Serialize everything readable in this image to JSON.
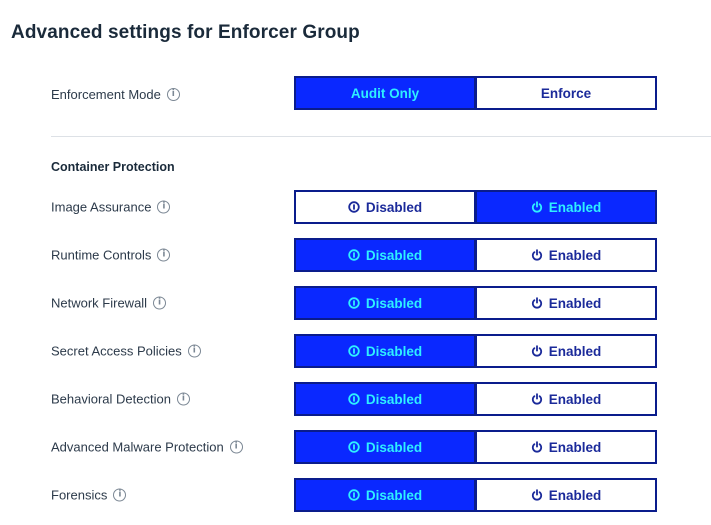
{
  "page_title": "Advanced settings for Enforcer Group",
  "enforcement": {
    "label": "Enforcement Mode",
    "options": [
      "Audit Only",
      "Enforce"
    ],
    "selected": "Audit Only"
  },
  "section": {
    "title": "Container Protection"
  },
  "colors": {
    "active_bg": "#0a28ff",
    "active_text": "#2ef0ff",
    "border": "#0a1c8c",
    "inactive_text": "#1b2a9a"
  },
  "settings": [
    {
      "label": "Image Assurance",
      "disabled_label": "Disabled",
      "enabled_label": "Enabled",
      "selected": "Enabled"
    },
    {
      "label": "Runtime Controls",
      "disabled_label": "Disabled",
      "enabled_label": "Enabled",
      "selected": "Disabled"
    },
    {
      "label": "Network Firewall",
      "disabled_label": "Disabled",
      "enabled_label": "Enabled",
      "selected": "Disabled"
    },
    {
      "label": "Secret Access Policies",
      "disabled_label": "Disabled",
      "enabled_label": "Enabled",
      "selected": "Disabled"
    },
    {
      "label": "Behavioral Detection",
      "disabled_label": "Disabled",
      "enabled_label": "Enabled",
      "selected": "Disabled"
    },
    {
      "label": "Advanced Malware Protection",
      "disabled_label": "Disabled",
      "enabled_label": "Enabled",
      "selected": "Disabled"
    },
    {
      "label": "Forensics",
      "disabled_label": "Disabled",
      "enabled_label": "Enabled",
      "selected": "Disabled"
    }
  ]
}
